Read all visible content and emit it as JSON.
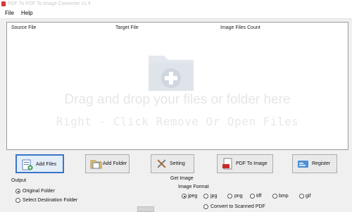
{
  "window": {
    "title": "PDF To PDF To Image Converter v1.4"
  },
  "menu": [
    "File",
    "Help"
  ],
  "file_list": {
    "columns": [
      "Source File",
      "Target File",
      "Image Files Count"
    ],
    "drag_hint": "Drag and drop your files or folder here",
    "right_click_hint": "Right - Click Remove Or Open Files"
  },
  "buttons": {
    "add_files": "Add Files",
    "add_folder": "Add Folder",
    "setting": "Setting",
    "pdf_to_image": "PDF To Image",
    "register": "Register"
  },
  "output": {
    "label": "Output",
    "options": [
      "Original Folder",
      "Select Destination Folder"
    ],
    "selected": "Original Folder"
  },
  "get_image": {
    "label": "Get Image",
    "format_label": "Image Format",
    "formats": [
      "jpeg",
      "jpg",
      "png",
      "tiff",
      "bmp",
      "gif"
    ],
    "selected": "jpeg",
    "scanned_option": "Convert to Scanned PDF"
  },
  "colors": {
    "active_border": "#3b76c9",
    "app_icon": "#d23a3a"
  }
}
